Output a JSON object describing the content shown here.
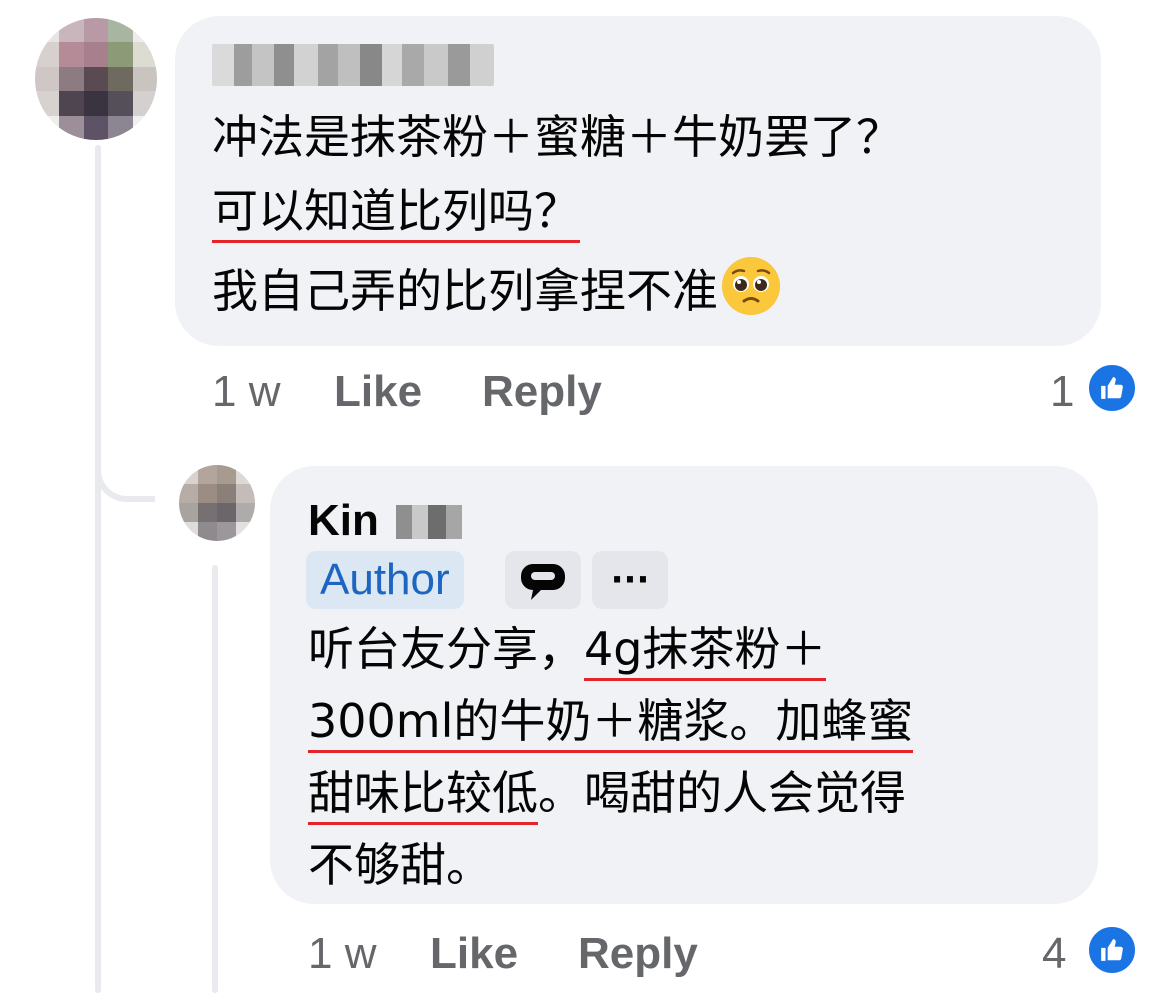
{
  "comment1": {
    "author_name_obscured": "",
    "lines": [
      "冲法是抹茶粉＋蜜糖＋牛奶罢了？",
      "可以知道比列吗？",
      "我自己弄的比列拿捏不准"
    ],
    "emoji": "🥹",
    "time": "1 w",
    "like_label": "Like",
    "reply_label": "Reply",
    "reaction_count": "1"
  },
  "reply1": {
    "author_first": "Kin",
    "badge": "Author",
    "more_label": "···",
    "line1_plain": "听台友分享，",
    "line1_ul": "4g抹茶粉＋",
    "line2_ul": "300ml的牛奶＋糖浆。加蜂蜜",
    "line3_ul": "甜味比较低",
    "line3_plain": "。喝甜的人会觉得",
    "line4": "不够甜。",
    "time": "1 w",
    "like_label": "Like",
    "reply_label": "Reply",
    "reaction_count": "4"
  },
  "colors": {
    "bubble": "#f0f2f5",
    "meta_text": "#65676b",
    "like_blue": "#1b74e4",
    "underline_red": "#e3242b",
    "author_badge_bg": "#dbe7f2",
    "author_badge_text": "#1d65c1"
  },
  "icons": [
    "thumbs-up-icon",
    "chat-bubble-icon",
    "more-options-icon",
    "pleading-face-emoji"
  ]
}
